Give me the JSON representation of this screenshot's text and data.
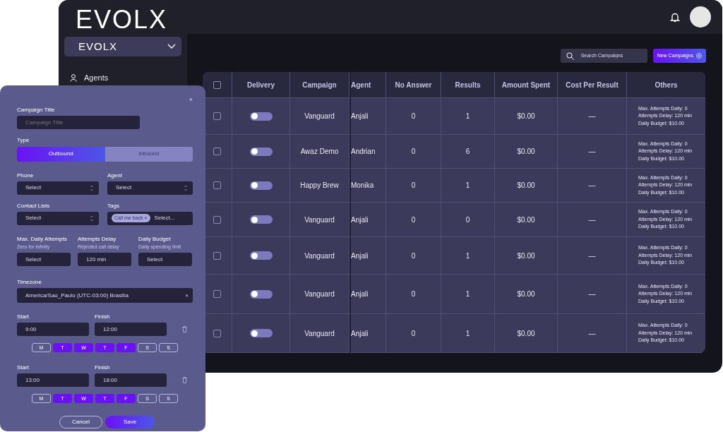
{
  "app": {
    "logo": "EVOLX",
    "workspace": "EVOLX",
    "sidebar": {
      "items": [
        {
          "label": "Agents"
        }
      ]
    },
    "search": {
      "placeholder": "Search Campaigns"
    },
    "new_button": "New Campaigns",
    "table": {
      "all_checked": false,
      "columns": [
        "Delivery",
        "Campaign",
        "Agent",
        "No Answer",
        "Results",
        "Amount Spent",
        "Cost Per Result",
        "Others"
      ],
      "rows": [
        {
          "checked": false,
          "on": false,
          "campaign": "Vanguard",
          "agent": "Anjali",
          "no_answer": "0",
          "results": "1",
          "amount_spent": "$0.00",
          "cost_per_result": "—",
          "others": [
            "Max. Attempts Daily: 0",
            "Attempts Delay: 120 min",
            "Daily Budget: $10.00"
          ]
        },
        {
          "checked": false,
          "on": false,
          "campaign": "Awaz Demo",
          "agent": "Andrian",
          "no_answer": "0",
          "results": "6",
          "amount_spent": "$0.00",
          "cost_per_result": "—",
          "others": [
            "Max. Attempts Daily: 0",
            "Attempts Delay: 120 min",
            "Daily Budget: $10.00"
          ]
        },
        {
          "checked": false,
          "on": false,
          "campaign": "Happy Brew",
          "agent": "Monika",
          "no_answer": "0",
          "results": "1",
          "amount_spent": "$0.00",
          "cost_per_result": "—",
          "others": [
            "Max. Attempts Daily: 0",
            "Attempts Delay: 120 min",
            "Daily Budget: $10.00"
          ]
        },
        {
          "checked": false,
          "on": false,
          "campaign": "Vanguard",
          "agent": "Anjali",
          "no_answer": "0",
          "results": "0",
          "amount_spent": "$0.00",
          "cost_per_result": "—",
          "others": [
            "Max. Attempts Daily: 0",
            "Attempts Delay: 120 min",
            "Daily Budget: $10.00"
          ]
        },
        {
          "checked": false,
          "on": false,
          "campaign": "Vanguard",
          "agent": "Anjali",
          "no_answer": "0",
          "results": "1",
          "amount_spent": "$0.00",
          "cost_per_result": "—",
          "others": [
            "Max. Attempts Daily: 0",
            "Attempts Delay: 120 min",
            "Daily Budget: $10.00"
          ]
        },
        {
          "checked": false,
          "on": false,
          "campaign": "Vanguard",
          "agent": "Anjali",
          "no_answer": "0",
          "results": "1",
          "amount_spent": "$0.00",
          "cost_per_result": "—",
          "others": [
            "Max. Attempts Daily: 0",
            "Attempts Delay: 120 min",
            "Daily Budget: $10.00"
          ]
        },
        {
          "checked": false,
          "on": false,
          "campaign": "Vanguard",
          "agent": "Anjali",
          "no_answer": "0",
          "results": "1",
          "amount_spent": "$0.00",
          "cost_per_result": "—",
          "others": [
            "Max. Attempts Daily: 0",
            "Attempts Delay: 120 min",
            "Daily Budget: $10.00"
          ]
        }
      ]
    }
  },
  "modal": {
    "close": "×",
    "title_label": "Campaign Title",
    "title_placeholder": "Campaign Title",
    "type_label": "Type",
    "type_options": [
      {
        "label": "Outbound",
        "selected": true
      },
      {
        "label": "Inbound",
        "selected": false
      }
    ],
    "fields": [
      {
        "kind": "select",
        "label": "Phone",
        "value": "Select"
      },
      {
        "kind": "select",
        "label": "Agent",
        "value": "Select"
      },
      {
        "kind": "select",
        "label": "Contact Lists",
        "value": "Select"
      },
      {
        "kind": "tags",
        "label": "Tags",
        "chips": [
          {
            "label": "Call me back",
            "remove": "×"
          }
        ],
        "value": "Select..."
      }
    ],
    "limits": [
      {
        "label": "Max. Daily Attempts",
        "hint": "Zero for infinity",
        "value": "Select"
      },
      {
        "label": "Attempts Delay",
        "hint": "Rejected call delay",
        "value": "120 min"
      },
      {
        "label": "Daily Budget",
        "hint": "Daily spending limit",
        "value": "Select"
      }
    ],
    "timezone": {
      "label": "Timezone",
      "value": "America/Sao_Paulo (UTC-03:00) Brasilia",
      "clear": "×"
    },
    "schedules": [
      {
        "start_label": "Start",
        "start": "9:00",
        "finish_label": "Finish",
        "finish": "12:00",
        "days": [
          {
            "label": "M",
            "selected": false
          },
          {
            "label": "T",
            "selected": true
          },
          {
            "label": "W",
            "selected": true
          },
          {
            "label": "T",
            "selected": true
          },
          {
            "label": "F",
            "selected": true
          },
          {
            "label": "S",
            "selected": false
          },
          {
            "label": "S",
            "selected": false
          }
        ]
      },
      {
        "start_label": "Start",
        "start": "13:00",
        "finish_label": "Finish",
        "finish": "18:00",
        "days": [
          {
            "label": "M",
            "selected": false
          },
          {
            "label": "T",
            "selected": true
          },
          {
            "label": "W",
            "selected": true
          },
          {
            "label": "T",
            "selected": true
          },
          {
            "label": "F",
            "selected": true
          },
          {
            "label": "S",
            "selected": false
          },
          {
            "label": "S",
            "selected": false
          }
        ]
      }
    ],
    "buttons": [
      {
        "label": "Cancel",
        "kind": "secondary"
      },
      {
        "label": "Save",
        "kind": "primary"
      }
    ]
  }
}
